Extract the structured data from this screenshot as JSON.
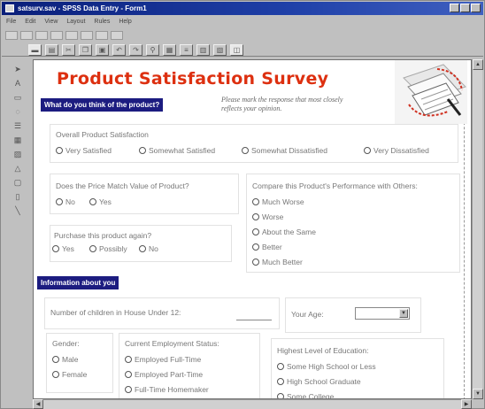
{
  "window": {
    "title": "satsurv.sav - SPSS Data Entry - Form1"
  },
  "menu": [
    "File",
    "Edit",
    "View",
    "Layout",
    "Rules",
    "Help"
  ],
  "toolbar": {
    "icons": [
      "save-icon",
      "print-icon",
      "cut-icon",
      "copy-icon",
      "paste-icon",
      "undo-icon",
      "redo-icon",
      "tool-icon",
      "grid-icon",
      "align-icon",
      "table-icon",
      "chart-icon",
      "dialog-icon"
    ]
  },
  "palette": {
    "tools": [
      "pointer-tool",
      "text-tool",
      "field-tool",
      "question-tool",
      "list-tool",
      "grid-tool",
      "image-tool",
      "shape-tool",
      "rule-tool",
      "page-tool",
      "line-tool"
    ]
  },
  "form": {
    "title": "Product Satisfaction Survey",
    "section1": "What do you think of the product?",
    "hint": "Please mark the response that most closely reflects your opinion.",
    "q_overall": {
      "label": "Overall Product Satisfaction",
      "options": [
        "Very Satisfied",
        "Somewhat Satisfied",
        "Somewhat Dissatisfied",
        "Very Dissatisfied"
      ]
    },
    "q_price": {
      "label": "Does the Price Match Value of Product?",
      "options": [
        "No",
        "Yes"
      ]
    },
    "q_compare": {
      "label": "Compare this Product's Performance with Others:",
      "options": [
        "Much Worse",
        "Worse",
        "About the Same",
        "Better",
        "Much Better"
      ]
    },
    "q_purchase": {
      "label": "Purchase this product again?",
      "options": [
        "Yes",
        "Possibly",
        "No"
      ]
    },
    "section2": "Information about you",
    "q_children": {
      "label": "Number of children in House Under 12:"
    },
    "q_age": {
      "label": "Your Age:"
    },
    "q_gender": {
      "label": "Gender:",
      "options": [
        "Male",
        "Female"
      ]
    },
    "q_employment": {
      "label": "Current Employment Status:",
      "options": [
        "Employed Full-Time",
        "Employed Part-Time",
        "Full-Time Homemaker"
      ]
    },
    "q_education": {
      "label": "Highest Level of Education:",
      "options": [
        "Some High School or Less",
        "High School Graduate",
        "Some College"
      ]
    }
  },
  "colors": {
    "title": "#dd3010",
    "section_bg": "#1c1c80",
    "titlebar": "#0a1f7a"
  }
}
